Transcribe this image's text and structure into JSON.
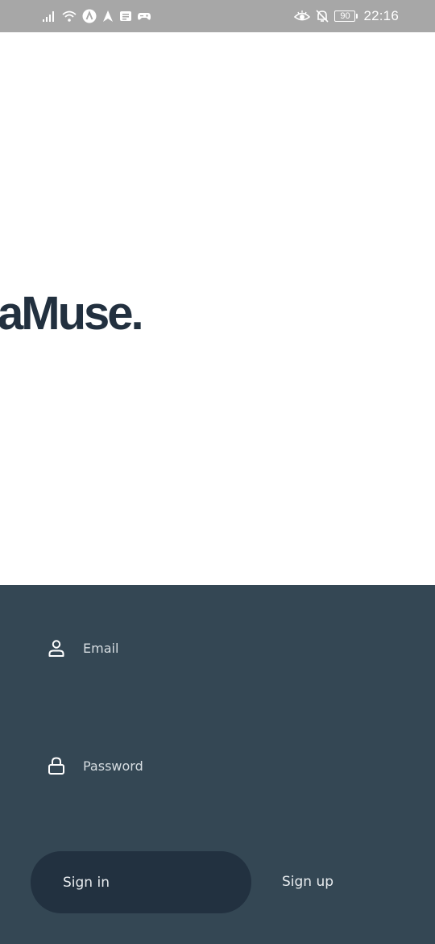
{
  "status_bar": {
    "left_icons": [
      "signal-icon",
      "wifi-icon",
      "a-badge-icon",
      "navigation-arrow-icon",
      "message-icon",
      "game-icon"
    ],
    "right_icons": [
      "eye-icon",
      "bell-off-icon"
    ],
    "battery_level": "90",
    "time": "22:16"
  },
  "app": {
    "logo_text": "aMuse."
  },
  "login": {
    "email": {
      "placeholder": "Email",
      "value": "",
      "icon": "user-icon"
    },
    "password": {
      "placeholder": "Password",
      "value": "",
      "icon": "lock-icon"
    },
    "signin_label": "Sign in",
    "signup_label": "Sign up"
  },
  "colors": {
    "panel": "#344754",
    "button": "#223140",
    "logo": "#22303f",
    "status_bar": "#a7a7a7"
  }
}
